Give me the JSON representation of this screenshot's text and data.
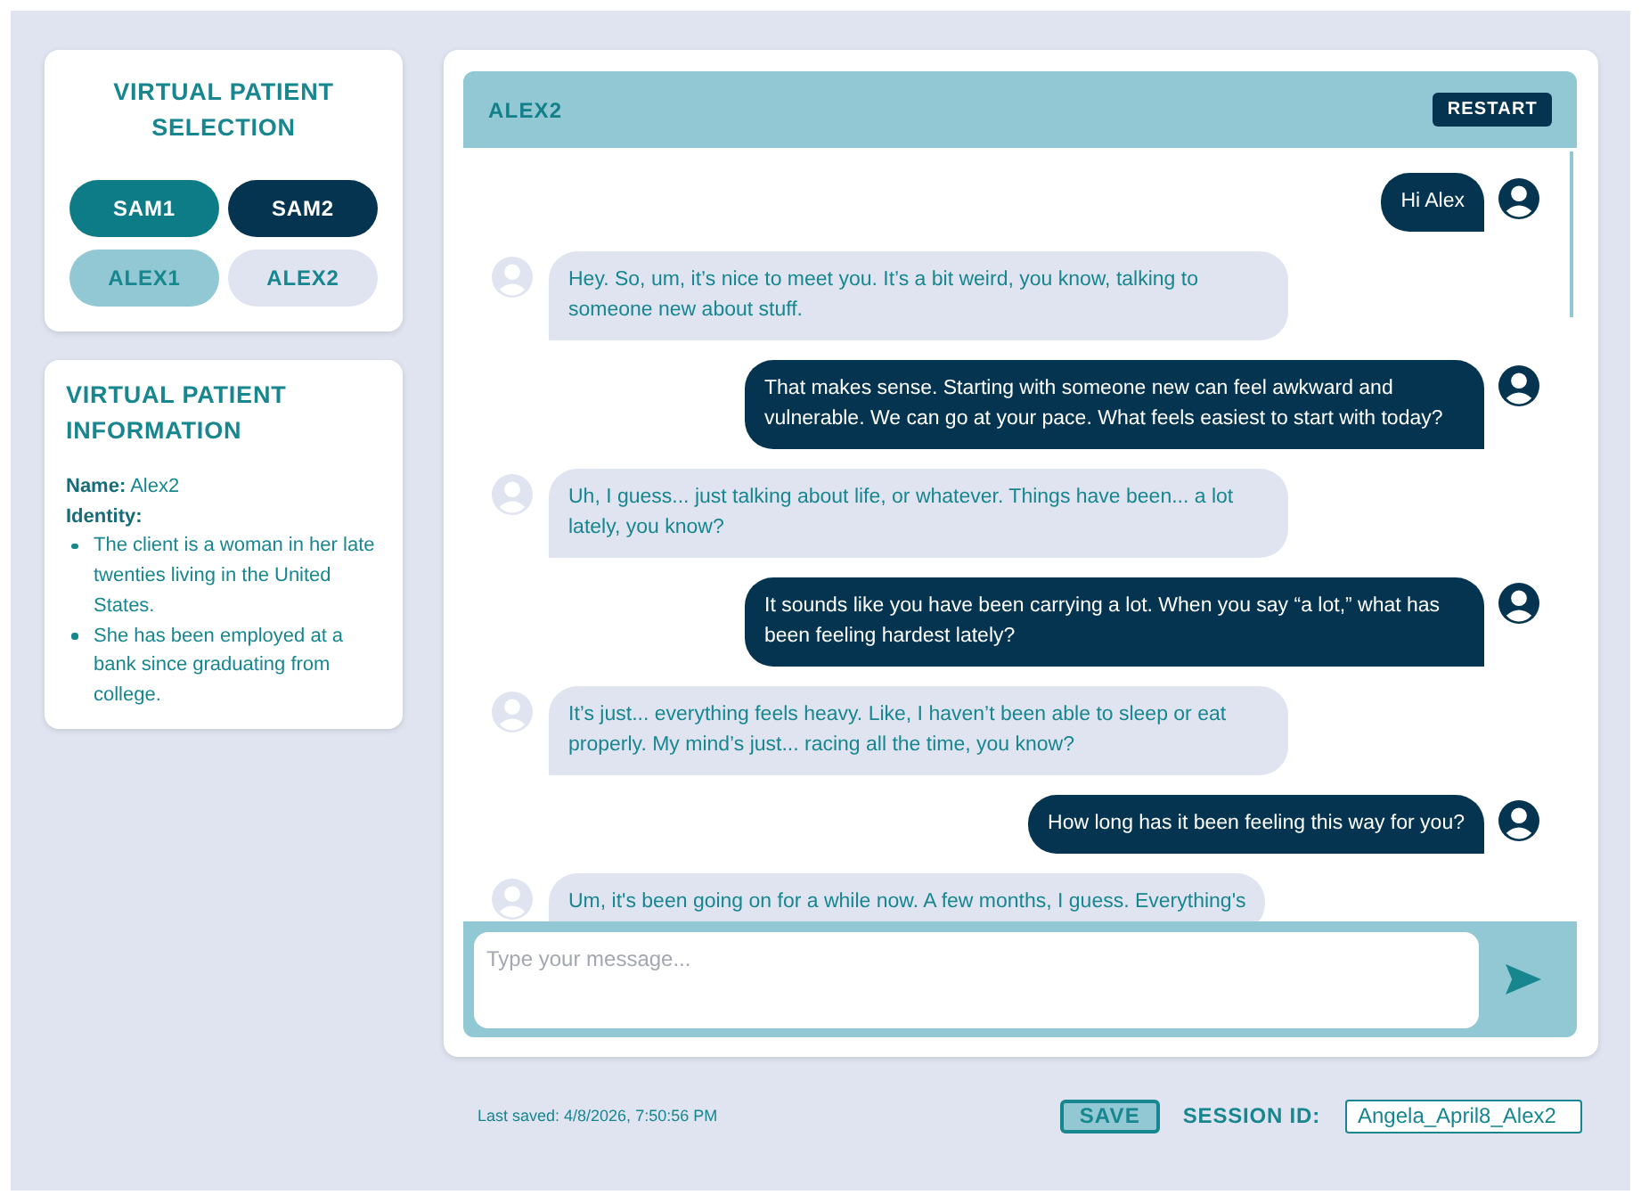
{
  "patient_selection": {
    "title": "VIRTUAL PATIENT SELECTION",
    "patients": [
      {
        "label": "SAM1",
        "color": "#0d7c86"
      },
      {
        "label": "SAM2",
        "color": "#04344f"
      },
      {
        "label": "ALEX1",
        "color": "#91c8d3"
      },
      {
        "label": "ALEX2",
        "color": "#dfe4f0"
      }
    ]
  },
  "patient_information": {
    "title": "VIRTUAL PATIENT INFORMATION",
    "name": "**Name:** Alex2",
    "identity_label": "Identity:",
    "identity": [
      "The client is a woman in her late twenties living in the United States.",
      "She has been employed at a bank since graduating from college."
    ]
  },
  "chat": {
    "title": "ALEX2",
    "restart_button": "RESTART",
    "messages": [
      {
        "kind": "user",
        "text": "Hi Alex"
      },
      {
        "kind": "patient",
        "text": "Hey. So, um, it’s nice to meet you. It’s a bit weird, you know, talking to someone new about stuff."
      },
      {
        "kind": "user",
        "text": "That makes sense. Starting with someone new can feel awkward and vulnerable. We can go at your pace. What feels easiest to start with today?"
      },
      {
        "kind": "patient",
        "text": "Uh, I guess... just talking about life, or whatever. Things have been... a lot lately, you know?"
      },
      {
        "kind": "user",
        "text": "It sounds like you have been carrying a lot. When you say “a lot,” what has been feeling hardest lately?"
      },
      {
        "kind": "patient",
        "text": "It’s just... everything feels heavy. Like, I haven’t been able to sleep or eat properly. My mind’s just... racing all the time, you know?"
      },
      {
        "kind": "user",
        "text": "How long has it been feeling this way for you?"
      },
      {
        "kind": "patient",
        "text": "Um, it's been going on for a while now. A few months, I guess. Everything's"
      }
    ],
    "input": {
      "placeholder": "Type your message..."
    }
  },
  "footer": {
    "last_saved": "Last saved: 4/8/2026, 7:50:56 PM",
    "save_button": "SAVE",
    "session_label": "SESSION ID:",
    "session_id": "Angela_April8_Alex2"
  }
}
